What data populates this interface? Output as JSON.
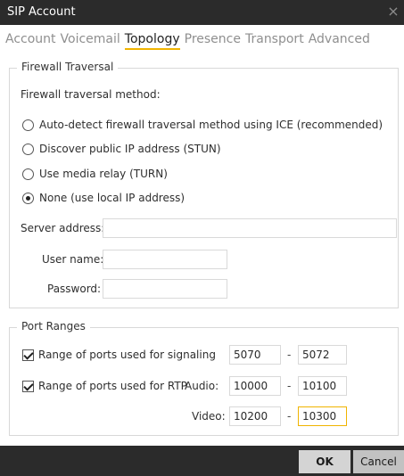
{
  "window": {
    "title": "SIP Account",
    "close_glyph": "×"
  },
  "tabs": [
    {
      "label": "Account",
      "active": false
    },
    {
      "label": "Voicemail",
      "active": false
    },
    {
      "label": "Topology",
      "active": true
    },
    {
      "label": "Presence",
      "active": false
    },
    {
      "label": "Transport",
      "active": false
    },
    {
      "label": "Advanced",
      "active": false
    }
  ],
  "firewall": {
    "group_title": "Firewall Traversal",
    "method_label": "Firewall traversal method:",
    "options": [
      {
        "label": "Auto-detect firewall traversal method using ICE (recommended)",
        "checked": false
      },
      {
        "label": "Discover public IP address (STUN)",
        "checked": false
      },
      {
        "label": "Use media relay (TURN)",
        "checked": false
      },
      {
        "label": "None (use local IP address)",
        "checked": true
      }
    ],
    "server_address_label": "Server address:",
    "server_address_value": "",
    "user_name_label": "User name:",
    "user_name_value": "",
    "password_label": "Password:",
    "password_value": ""
  },
  "ports": {
    "group_title": "Port Ranges",
    "signaling": {
      "label": "Range of ports used for signaling",
      "checked": true,
      "from": "5070",
      "to": "5072"
    },
    "rtp": {
      "label": "Range of ports used for RTP",
      "checked": true
    },
    "audio": {
      "label": "Audio:",
      "from": "10000",
      "to": "10100"
    },
    "video": {
      "label": "Video:",
      "from": "10200",
      "to": "10300"
    },
    "separator": "-"
  },
  "buttons": {
    "ok": "OK",
    "cancel": "Cancel"
  },
  "colors": {
    "accent": "#f0b400",
    "titlebar": "#2b2b2b",
    "inactive_tab": "#8f8f8f"
  },
  "icons": {
    "close": "close-icon",
    "checkbox": "checkbox-checked-icon",
    "radio": "radio-icon"
  }
}
